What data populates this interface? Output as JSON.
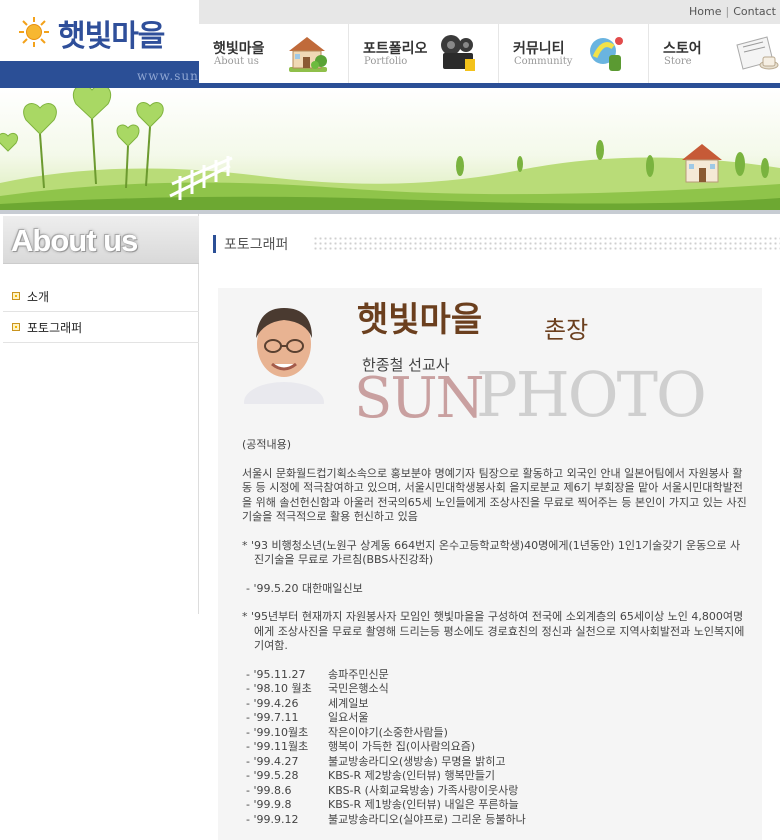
{
  "header": {
    "logo_text": "햇빛마을",
    "logo_url": "www.sunphoto",
    "top_links": [
      "Home",
      "Contact"
    ]
  },
  "nav": [
    {
      "ko": "햇빛마을",
      "en": "About us",
      "icon": "house-icon"
    },
    {
      "ko": "포트폴리오",
      "en": "Portfolio",
      "icon": "film-camera-icon"
    },
    {
      "ko": "커뮤니티",
      "en": "Community",
      "icon": "communication-icon"
    },
    {
      "ko": "스토어",
      "en": "Store",
      "icon": "newspaper-coffee-icon"
    }
  ],
  "sidebar": {
    "title": "About us",
    "items": [
      {
        "label": "소개"
      },
      {
        "label": "포토그래퍼"
      }
    ]
  },
  "content": {
    "heading": "포토그래퍼",
    "village_title": "햇빛마을",
    "chief": "촌장",
    "name_line": "한종철 선교사",
    "sun_word": "SUN",
    "photo_word": "PHOTO",
    "section_label": "(공적내용)",
    "paragraph_1": "서울시 문화월드컵기획소속으로 홍보분야 명예기자 팀장으로 활동하고 외국인 안내 일본어팀에서 자원봉사 활동 등 시정에 적극참여하고 있으며, 서울시민대학생봉사회 을지로분교 제6기 부회장을 맡아 서울시민대학발전을 위해 솔선헌신함과 아울러 전국의65세 노인들에게 조상사진을 무료로 찍어주는 등 본인이 가지고 있는 사진기술을 적극적으로 활용 헌신하고 있음",
    "bullet_1": "* '93 비행청소년(노원구 상계동 664번지 온수고등학교학생)40명에게(1년동안) 1인1기술갖기 운동으로 사진기술을 무료로 가르침(BBS사진강좌)",
    "dash_1": "- '99.5.20 대한매일신보",
    "bullet_2": "* '95년부터 현재까지 자원봉사자 모임인 햇빛마을을 구성하여 전국에 소외계층의 65세이상 노인 4,800여명에게 조상사진을 무료로 촬영해 드리는등 평소에도 경로효친의 정신과 실천으로 지역사회발전과 노인복지에 기여함.",
    "timeline": [
      {
        "date": "- '95.11.27",
        "text": "송파주민신문"
      },
      {
        "date": "- '98.10 월초",
        "text": "국민은행소식"
      },
      {
        "date": "- '99.4.26",
        "text": "세계일보"
      },
      {
        "date": "- '99.7.11",
        "text": "일요서울"
      },
      {
        "date": "- '99.10월초",
        "text": "작은이야기(소중한사람들)"
      },
      {
        "date": "- '99.11월초",
        "text": "행복이 가득한 집(이사람의요즘)"
      },
      {
        "date": "- '99.4.27",
        "text": "불교방송라디오(생방송) 무명을 밝히고"
      },
      {
        "date": "- '99.5.28",
        "text": "KBS-R 제2방송(인터뷰) 행복만들기"
      },
      {
        "date": "- '99.8.6",
        "text": "KBS-R (사회교육방송) 가족사랑이웃사랑"
      },
      {
        "date": "- '99.9.8",
        "text": "KBS-R 제1방송(인터뷰) 내일은 푸른하늘"
      },
      {
        "date": "- '99.9.12",
        "text": "불교방송라디오(실야프로) 그리운 등불하나"
      }
    ]
  },
  "colors": {
    "brand_blue": "#2b4f96",
    "title_brown": "#6b3f1e",
    "bullet_gold": "#f2b600"
  }
}
